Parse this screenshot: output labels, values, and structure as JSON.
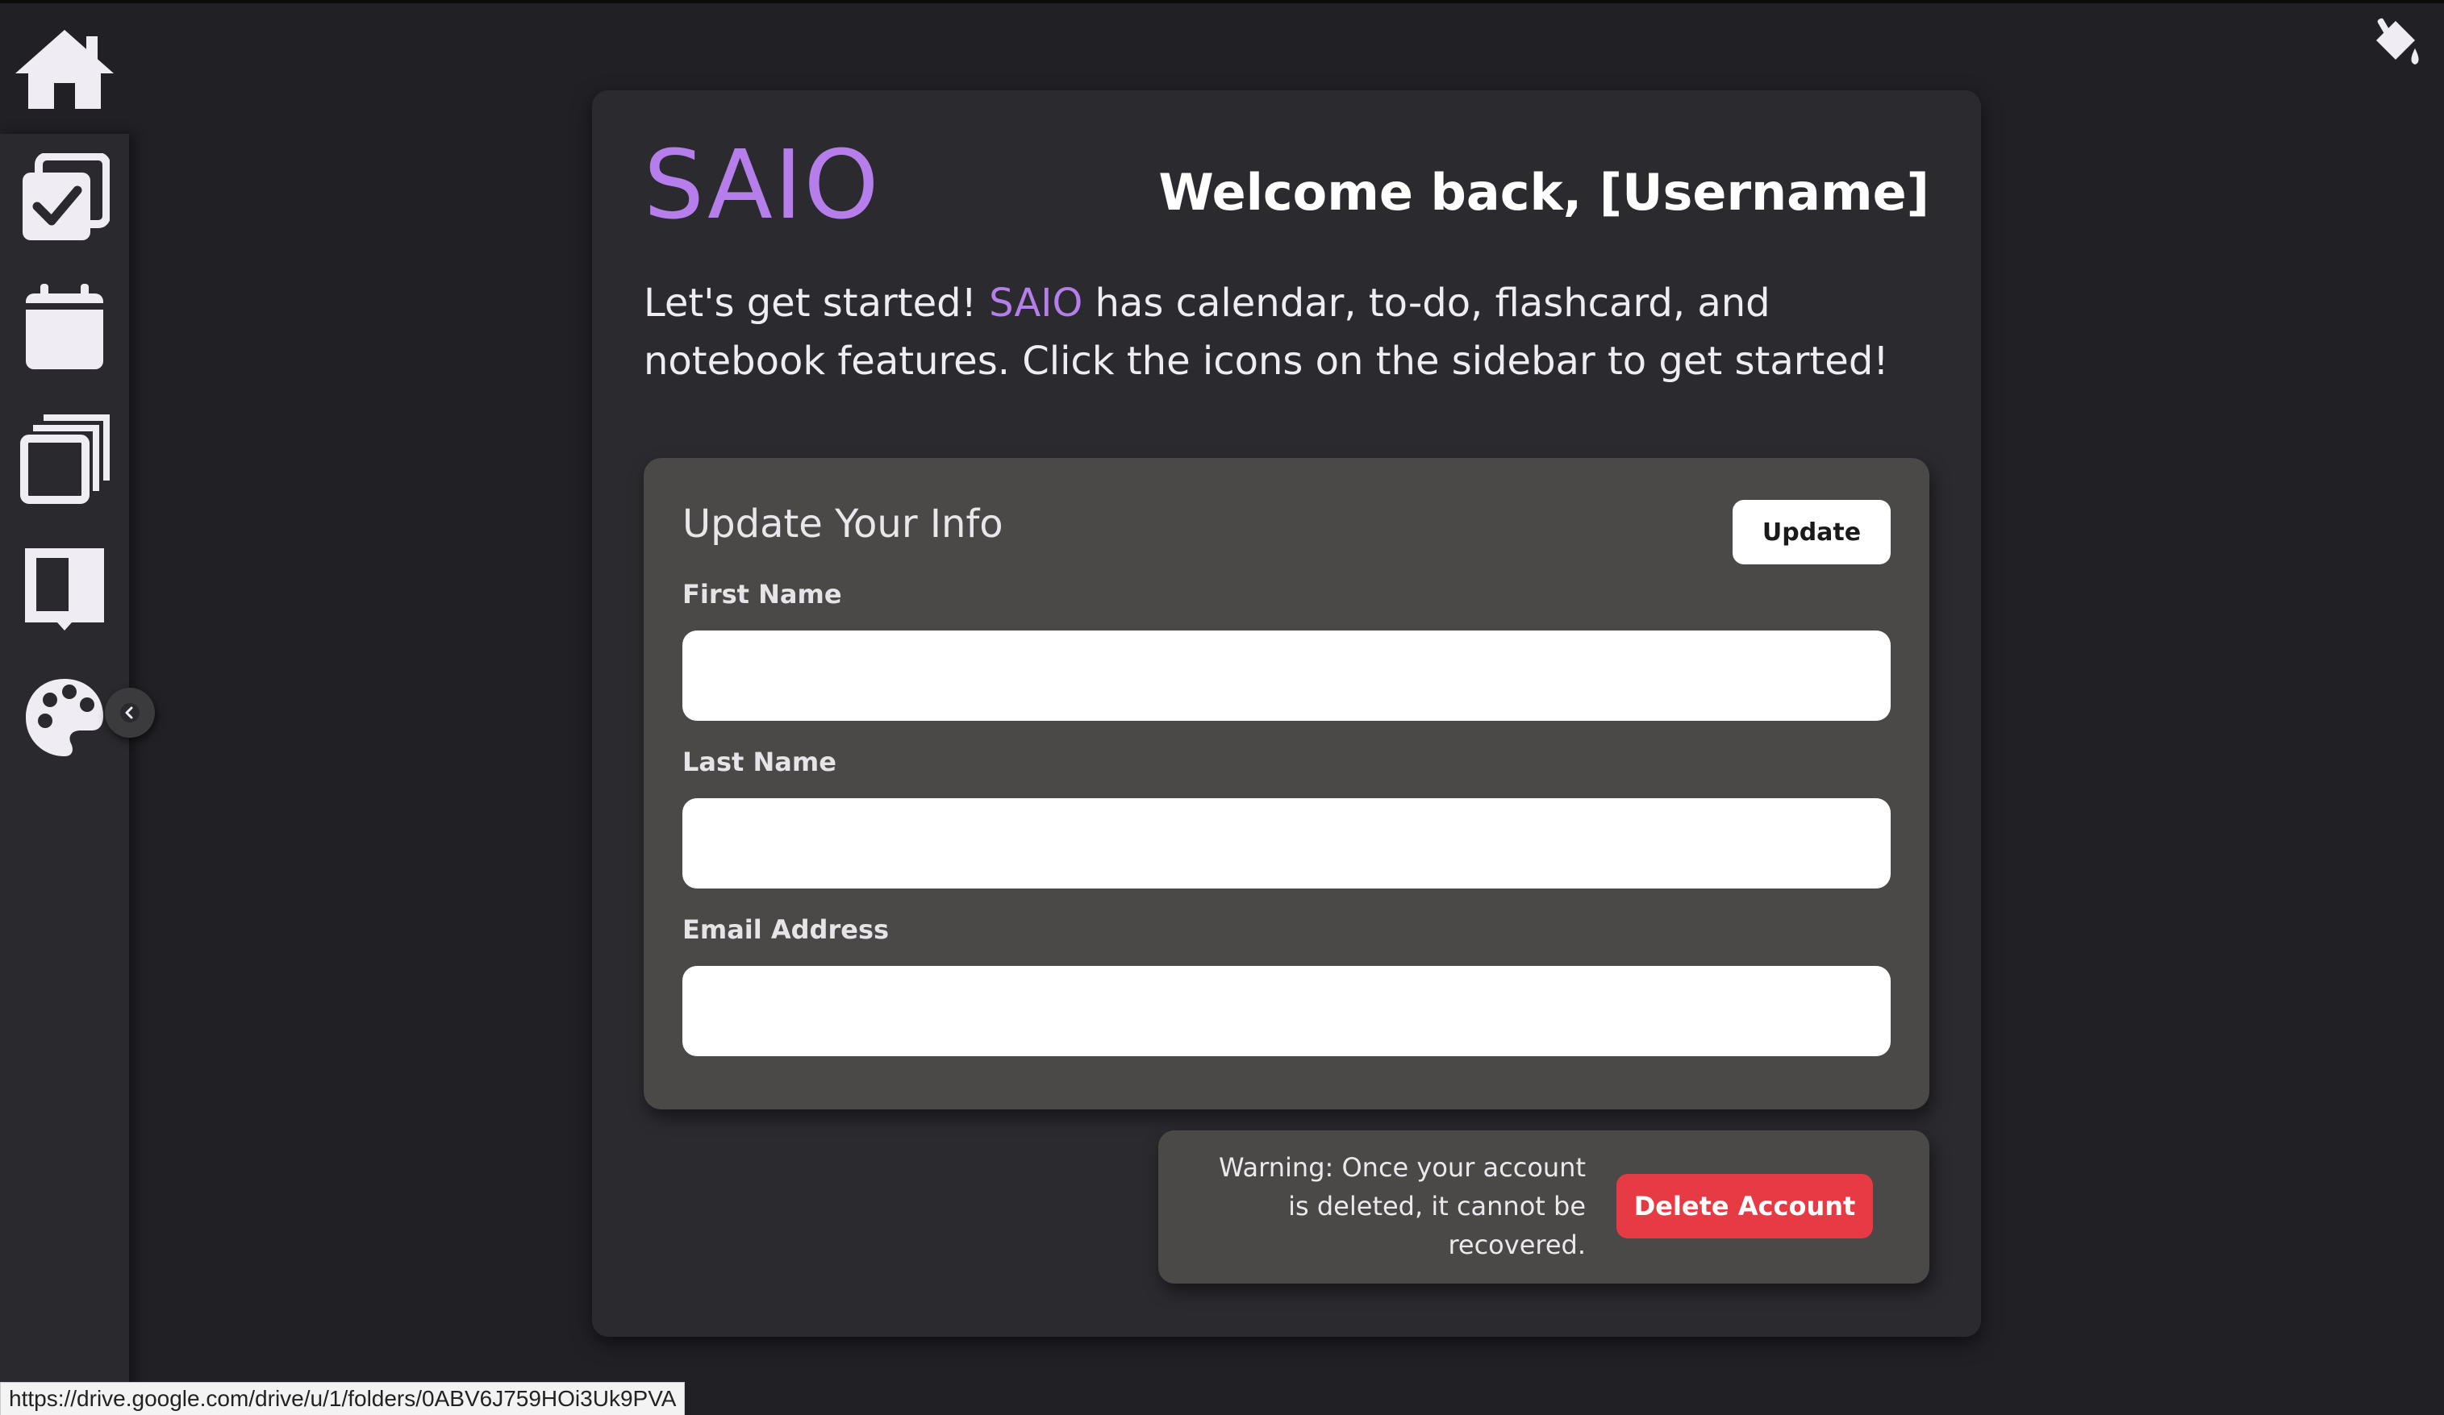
{
  "sidebar": {
    "items": [
      {
        "name": "home",
        "icon": "home-icon"
      },
      {
        "name": "todo",
        "icon": "checklist-icon"
      },
      {
        "name": "calendar",
        "icon": "calendar-icon"
      },
      {
        "name": "flashcards",
        "icon": "cards-icon"
      },
      {
        "name": "notebook",
        "icon": "book-icon"
      },
      {
        "name": "themes",
        "icon": "palette-icon"
      }
    ],
    "collapse_icon": "chevron-left-icon"
  },
  "top_right_icon": "paint-bucket-icon",
  "header": {
    "brand": "SAIO",
    "welcome": "Welcome back, [Username]"
  },
  "intro": {
    "before": "Let's get started! ",
    "brand": "SAIO",
    "after": " has calendar, to-do, flashcard, and notebook features. Click the icons on the sidebar to get started!"
  },
  "update_form": {
    "title": "Update Your Info",
    "update_label": "Update",
    "fields": [
      {
        "label": "First Name",
        "value": ""
      },
      {
        "label": "Last Name",
        "value": ""
      },
      {
        "label": "Email Address",
        "value": ""
      }
    ]
  },
  "danger_zone": {
    "warning": "Warning: Once your account is deleted, it cannot be recovered.",
    "delete_label": "Delete Account"
  },
  "status_bar": {
    "url": "https://drive.google.com/drive/u/1/folders/0ABV6J759HOi3Uk9PVA"
  },
  "colors": {
    "accent": "#b57eea",
    "background": "#212025",
    "panel": "#4b4848",
    "danger": "#e63b45"
  }
}
